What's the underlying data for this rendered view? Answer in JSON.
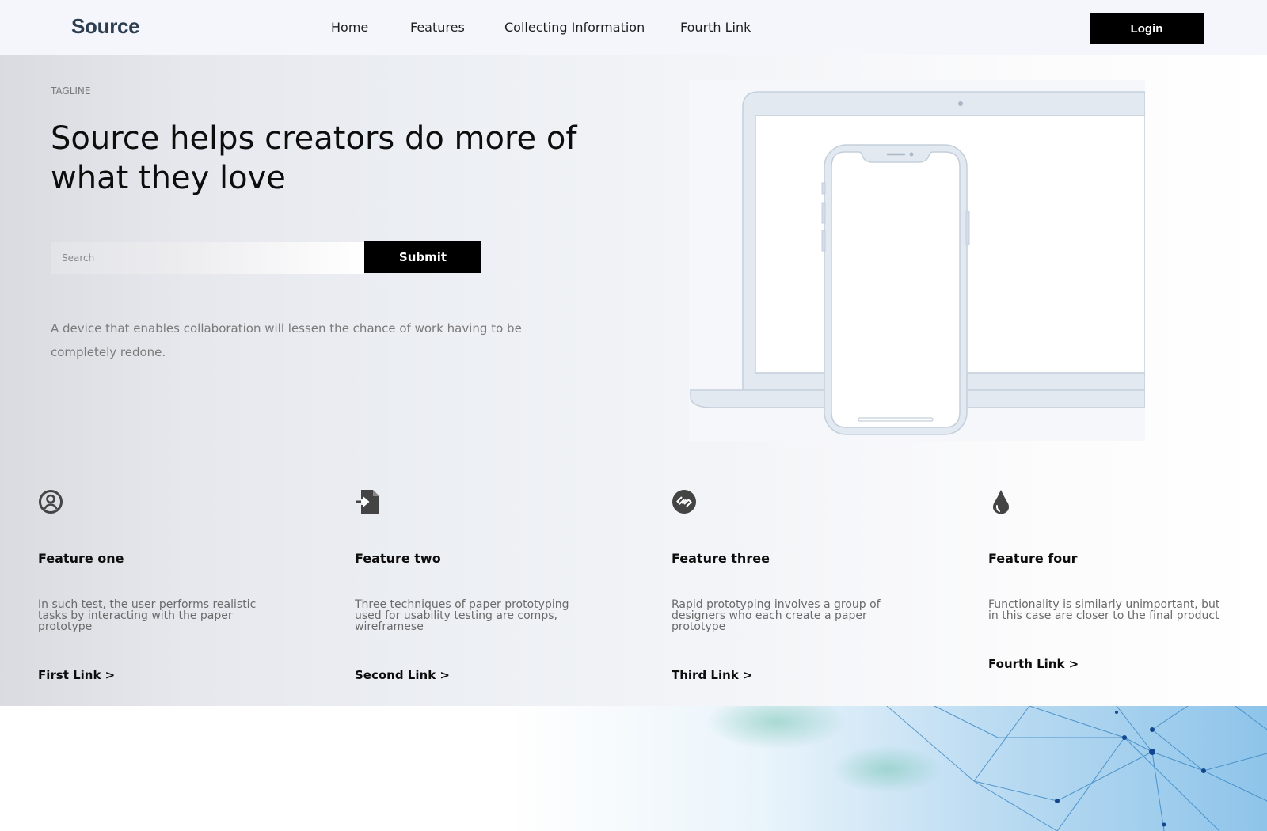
{
  "header": {
    "logo": "Source",
    "nav": [
      {
        "label": "Home"
      },
      {
        "label": "Features"
      },
      {
        "label": "Collecting Information"
      },
      {
        "label": "Fourth Link"
      }
    ],
    "login_label": "Login"
  },
  "hero": {
    "tagline": "TAGLINE",
    "headline": "Source helps creators do more of what they love",
    "search_placeholder": "Search",
    "submit_label": "Submit",
    "description": "A device that enables collaboration will lessen the chance of work having to be completely redone."
  },
  "features": [
    {
      "icon": "user-circle-icon",
      "title": "Feature one",
      "text": "In such test, the user performs realistic tasks by interacting with the paper prototype",
      "link": "First Link >"
    },
    {
      "icon": "file-import-icon",
      "title": "Feature two",
      "text": "Three techniques of paper prototyping used for usability testing are comps, wireframese",
      "link": "Second Link >"
    },
    {
      "icon": "link-circle-icon",
      "title": "Feature three",
      "text": "Rapid prototyping involves a group of designers who each create a paper prototype",
      "link": "Third Link >"
    },
    {
      "icon": "droplet-icon",
      "title": "Feature four",
      "text": "Functionality is similarly unimportant, but in this case are closer to the final product",
      "link": "Fourth Link >"
    }
  ],
  "colors": {
    "header_bg": "#f4f6fb",
    "button_bg": "#000000",
    "logo": "#2c3e50",
    "icon": "#444444",
    "device_outline": "#c3cfdc",
    "device_fill": "#e3e9f0"
  }
}
